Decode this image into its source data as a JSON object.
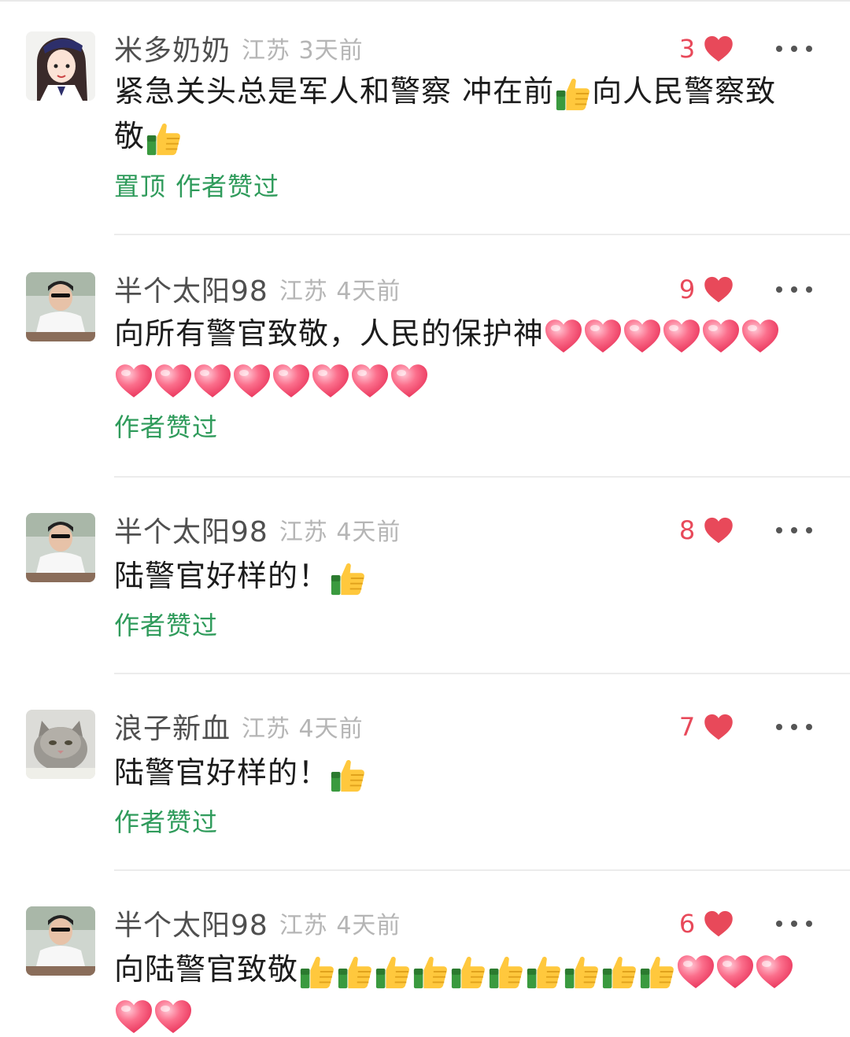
{
  "comments": [
    {
      "user": "米多奶奶",
      "location_time": "江苏 3天前",
      "likes": "3",
      "text_parts": [
        "紧急关头总是军人和警察 冲在前",
        "向人民警察致敬"
      ],
      "tags": [
        "置顶",
        "作者赞过"
      ]
    },
    {
      "user": "半个太阳98",
      "location_time": "江苏 4天前",
      "likes": "9",
      "text_parts": [
        "向所有警官致敬，人民的保护神"
      ],
      "tags": [
        "作者赞过"
      ]
    },
    {
      "user": "半个太阳98",
      "location_time": "江苏 4天前",
      "likes": "8",
      "text_parts": [
        "陆警官好样的！"
      ],
      "tags": [
        "作者赞过"
      ]
    },
    {
      "user": "浪子新血",
      "location_time": "江苏 4天前",
      "likes": "7",
      "text_parts": [
        "陆警官好样的！"
      ],
      "tags": [
        "作者赞过"
      ]
    },
    {
      "user": "半个太阳98",
      "location_time": "江苏 4天前",
      "likes": "6",
      "text_parts": [
        "向陆警官致敬"
      ],
      "tags": []
    }
  ],
  "icons": {
    "like": "heart-icon",
    "more": "more-icon",
    "emoji_thumb": "thumbs-up-emoji",
    "emoji_heart": "red-heart-emoji"
  },
  "colors": {
    "like_red": "#e8495a",
    "tag_green": "#2f9b5b",
    "username_gray": "#4f4f4f",
    "meta_gray": "#b5b5b5"
  }
}
